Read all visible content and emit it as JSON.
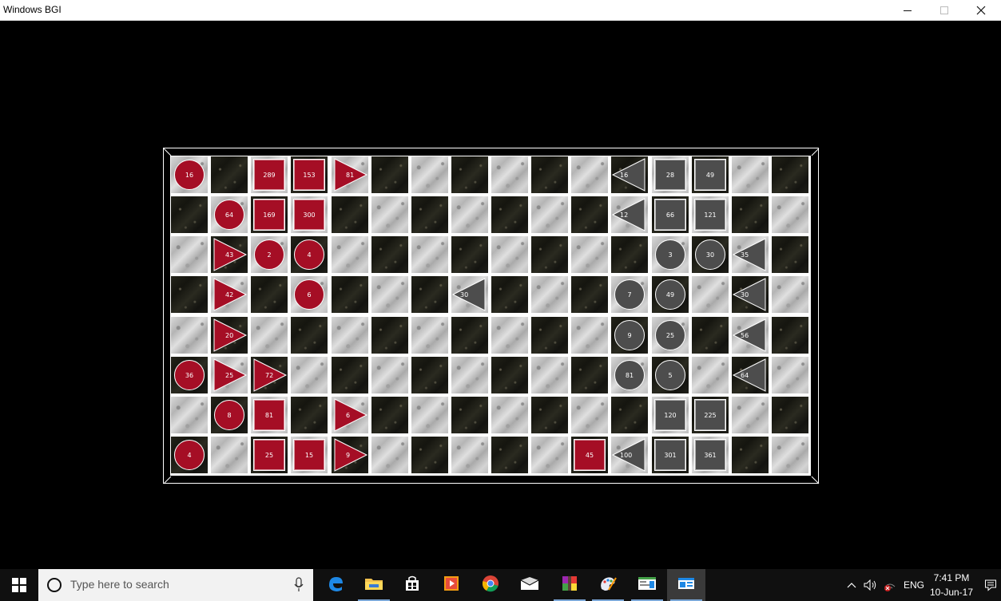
{
  "window": {
    "title": "Windows BGI",
    "minimize_label": "–",
    "maximize_label": "□",
    "close_label": "✕"
  },
  "colors": {
    "red_piece": "#a50e25",
    "gray_piece": "#4d4d4d",
    "taskbar": "#101010"
  },
  "board": {
    "rows": 8,
    "cols": 16,
    "pieces": [
      {
        "row": 0,
        "col": 0,
        "shape": "circle",
        "color": "red",
        "label": "16"
      },
      {
        "row": 0,
        "col": 2,
        "shape": "square",
        "color": "red",
        "label": "289"
      },
      {
        "row": 0,
        "col": 3,
        "shape": "square",
        "color": "red",
        "label": "153"
      },
      {
        "row": 0,
        "col": 4,
        "shape": "triangle-right",
        "color": "red",
        "label": "81"
      },
      {
        "row": 0,
        "col": 11,
        "shape": "triangle-left",
        "color": "gray",
        "label": "16"
      },
      {
        "row": 0,
        "col": 12,
        "shape": "square",
        "color": "gray",
        "label": "28"
      },
      {
        "row": 0,
        "col": 13,
        "shape": "square",
        "color": "gray",
        "label": "49"
      },
      {
        "row": 1,
        "col": 1,
        "shape": "circle",
        "color": "red",
        "label": "64"
      },
      {
        "row": 1,
        "col": 2,
        "shape": "square",
        "color": "red",
        "label": "169"
      },
      {
        "row": 1,
        "col": 3,
        "shape": "square",
        "color": "red",
        "label": "300"
      },
      {
        "row": 1,
        "col": 11,
        "shape": "triangle-left",
        "color": "gray",
        "label": "12"
      },
      {
        "row": 1,
        "col": 12,
        "shape": "square",
        "color": "gray",
        "label": "66"
      },
      {
        "row": 1,
        "col": 13,
        "shape": "square",
        "color": "gray",
        "label": "121"
      },
      {
        "row": 2,
        "col": 1,
        "shape": "triangle-right",
        "color": "red",
        "label": "43"
      },
      {
        "row": 2,
        "col": 2,
        "shape": "circle",
        "color": "red",
        "label": "2"
      },
      {
        "row": 2,
        "col": 3,
        "shape": "circle",
        "color": "red",
        "label": "4"
      },
      {
        "row": 2,
        "col": 12,
        "shape": "circle",
        "color": "gray",
        "label": "3"
      },
      {
        "row": 2,
        "col": 13,
        "shape": "circle",
        "color": "gray",
        "label": "30"
      },
      {
        "row": 2,
        "col": 14,
        "shape": "triangle-left",
        "color": "gray",
        "label": "35"
      },
      {
        "row": 3,
        "col": 1,
        "shape": "triangle-right",
        "color": "red",
        "label": "42"
      },
      {
        "row": 3,
        "col": 3,
        "shape": "circle",
        "color": "red",
        "label": "6"
      },
      {
        "row": 3,
        "col": 7,
        "shape": "triangle-left",
        "color": "gray",
        "label": "30"
      },
      {
        "row": 3,
        "col": 11,
        "shape": "circle",
        "color": "gray",
        "label": "7"
      },
      {
        "row": 3,
        "col": 12,
        "shape": "circle",
        "color": "gray",
        "label": "49"
      },
      {
        "row": 3,
        "col": 14,
        "shape": "triangle-left",
        "color": "gray",
        "label": "30"
      },
      {
        "row": 4,
        "col": 1,
        "shape": "triangle-right",
        "color": "red",
        "label": "20"
      },
      {
        "row": 4,
        "col": 11,
        "shape": "circle",
        "color": "gray",
        "label": "9"
      },
      {
        "row": 4,
        "col": 12,
        "shape": "circle",
        "color": "gray",
        "label": "25"
      },
      {
        "row": 4,
        "col": 14,
        "shape": "triangle-left",
        "color": "gray",
        "label": "56"
      },
      {
        "row": 5,
        "col": 0,
        "shape": "circle",
        "color": "red",
        "label": "36"
      },
      {
        "row": 5,
        "col": 1,
        "shape": "triangle-right",
        "color": "red",
        "label": "25"
      },
      {
        "row": 5,
        "col": 2,
        "shape": "triangle-right",
        "color": "red",
        "label": "72"
      },
      {
        "row": 5,
        "col": 11,
        "shape": "circle",
        "color": "gray",
        "label": "81"
      },
      {
        "row": 5,
        "col": 12,
        "shape": "circle",
        "color": "gray",
        "label": "5"
      },
      {
        "row": 5,
        "col": 14,
        "shape": "triangle-left",
        "color": "gray",
        "label": "64"
      },
      {
        "row": 6,
        "col": 1,
        "shape": "circle",
        "color": "red",
        "label": "8"
      },
      {
        "row": 6,
        "col": 2,
        "shape": "square",
        "color": "red",
        "label": "81"
      },
      {
        "row": 6,
        "col": 4,
        "shape": "triangle-right",
        "color": "red",
        "label": "6"
      },
      {
        "row": 6,
        "col": 12,
        "shape": "square",
        "color": "gray",
        "label": "120"
      },
      {
        "row": 6,
        "col": 13,
        "shape": "square",
        "color": "gray",
        "label": "225"
      },
      {
        "row": 7,
        "col": 0,
        "shape": "circle",
        "color": "red",
        "label": "4"
      },
      {
        "row": 7,
        "col": 2,
        "shape": "square",
        "color": "red",
        "label": "25"
      },
      {
        "row": 7,
        "col": 3,
        "shape": "square",
        "color": "red",
        "label": "15"
      },
      {
        "row": 7,
        "col": 4,
        "shape": "triangle-right",
        "color": "red",
        "label": "9"
      },
      {
        "row": 7,
        "col": 10,
        "shape": "square",
        "color": "red",
        "label": "45"
      },
      {
        "row": 7,
        "col": 11,
        "shape": "triangle-left",
        "color": "gray",
        "label": "100"
      },
      {
        "row": 7,
        "col": 12,
        "shape": "square",
        "color": "gray",
        "label": "301"
      },
      {
        "row": 7,
        "col": 13,
        "shape": "square",
        "color": "gray",
        "label": "361"
      }
    ]
  },
  "taskbar": {
    "search_placeholder": "Type here to search",
    "apps": [
      {
        "name": "edge-icon",
        "running": false,
        "active": false
      },
      {
        "name": "file-explorer-icon",
        "running": true,
        "active": false
      },
      {
        "name": "store-icon",
        "running": false,
        "active": false
      },
      {
        "name": "media-player-icon",
        "running": false,
        "active": false
      },
      {
        "name": "chrome-icon",
        "running": false,
        "active": false
      },
      {
        "name": "mail-icon",
        "running": false,
        "active": false
      },
      {
        "name": "winrar-icon",
        "running": true,
        "active": false
      },
      {
        "name": "paint-icon",
        "running": true,
        "active": false
      },
      {
        "name": "codeblocks-icon",
        "running": true,
        "active": false
      },
      {
        "name": "bgi-window-icon",
        "running": true,
        "active": true
      }
    ],
    "tray": {
      "language": "ENG",
      "time": "7:41 PM",
      "date": "10-Jun-17"
    }
  }
}
